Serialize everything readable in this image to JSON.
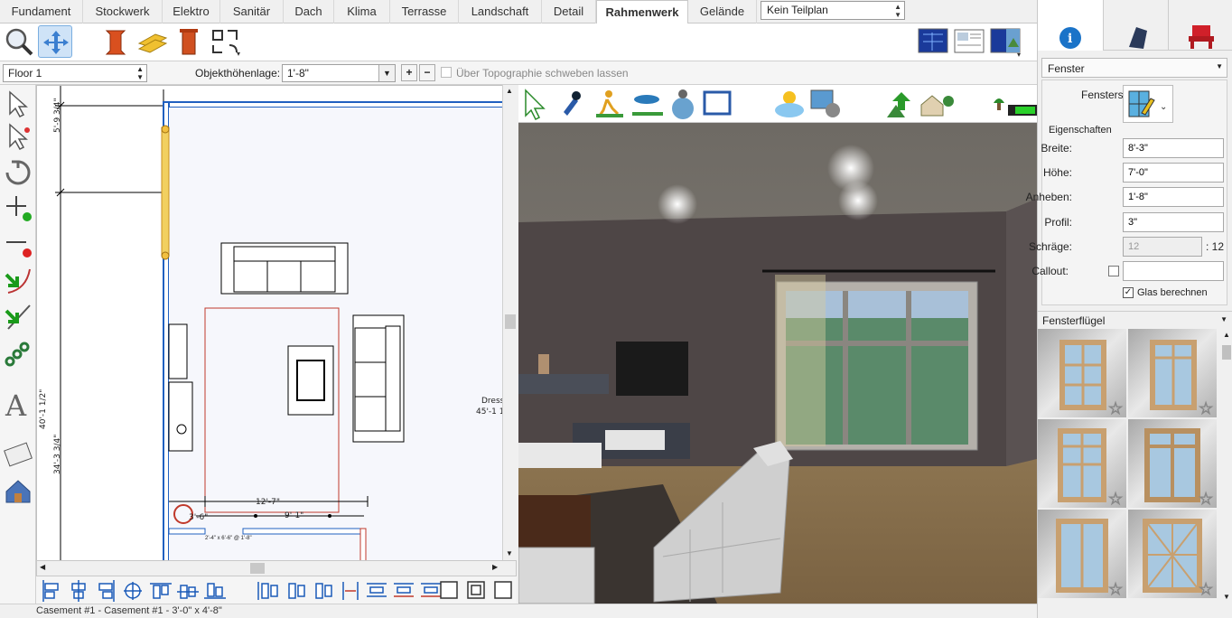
{
  "tabs": [
    "Fundament",
    "Stockwerk",
    "Elektro",
    "Sanitär",
    "Dach",
    "Klima",
    "Terrasse",
    "Landschaft",
    "Detail",
    "Rahmenwerk",
    "Gelände"
  ],
  "active_tab": "Rahmenwerk",
  "teilplan": "Kein Teilplan",
  "toolbar2": {
    "floor": "Floor 1",
    "height_label": "Objekthöhenlage:",
    "height_value": "1'-8\"",
    "topo_label": "Über Topographie schweben lassen"
  },
  "plan": {
    "dim_left_top": "5'-9 3/4\"",
    "dim_left_mid": "40'-1 1/2\"",
    "dim_left_bottom": "34'-3 3/4\"",
    "dim_width": "12'-7\"",
    "dim_inner": "9'-1\"",
    "dim_small": "3'-6\"",
    "window_note": "2'-4\" x 6'-6\" @ 1'-8\"",
    "side_label_1": "Dress",
    "side_label_2": "45'-1 1"
  },
  "right_panel": {
    "category": "Fenster",
    "style_label": "Fensterstil",
    "section_label": "Eigenschaften",
    "fields": [
      {
        "label": "Breite:",
        "value": "8'-3\""
      },
      {
        "label": "Höhe:",
        "value": "7'-0\""
      },
      {
        "label": "Anheben:",
        "value": "1'-8\""
      },
      {
        "label": "Profil:",
        "value": "3\""
      },
      {
        "label": "Schräge:",
        "value": "12"
      },
      {
        "label": "Callout:",
        "value": ""
      }
    ],
    "slope_suffix": ": 12",
    "glass_label": "Glas berechnen",
    "glass_checked": true,
    "library_label": "Fensterflügel"
  },
  "status": "Casement #1   -   Casement #1   -   3'-0\" x 4'-8\"",
  "colors": {
    "accent": "#1a73c8",
    "wall": "#2060c0",
    "selection": "#c0392b"
  }
}
